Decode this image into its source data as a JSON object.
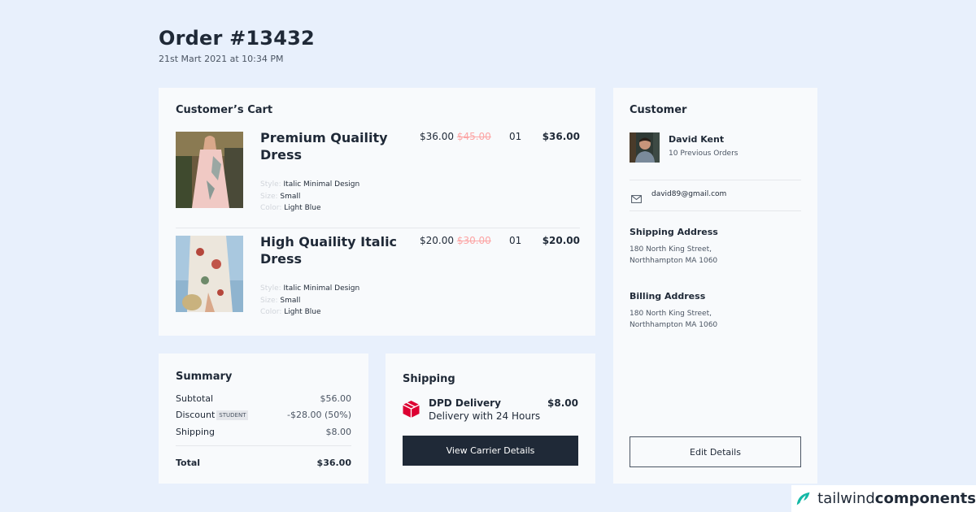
{
  "order": {
    "title": "Order #13432",
    "date": "21st Mart 2021 at 10:34 PM"
  },
  "cart": {
    "title": "Customer’s Cart",
    "items": [
      {
        "name": "Premium Quaility Dress",
        "style_label": "Style:",
        "style_value": "Italic Minimal Design",
        "size_label": "Size:",
        "size_value": "Small",
        "color_label": "Color:",
        "color_value": "Light Blue",
        "price": "$36.00",
        "old_price": "$45.00",
        "quantity": "01",
        "total": "$36.00"
      },
      {
        "name": "High Quaility Italic Dress",
        "style_label": "Style:",
        "style_value": "Italic Minimal Design",
        "size_label": "Size:",
        "size_value": "Small",
        "color_label": "Color:",
        "color_value": "Light Blue",
        "price": "$20.00",
        "old_price": "$30.00",
        "quantity": "01",
        "total": "$20.00"
      }
    ]
  },
  "summary": {
    "title": "Summary",
    "subtotal_label": "Subtotal",
    "subtotal_value": "$56.00",
    "discount_label": "Discount",
    "discount_badge": "STUDENT",
    "discount_value": "-$28.00 (50%)",
    "shipping_label": "Shipping",
    "shipping_value": "$8.00",
    "total_label": "Total",
    "total_value": "$36.00"
  },
  "shipping": {
    "title": "Shipping",
    "carrier_name": "DPD Delivery",
    "carrier_desc": "Delivery with 24 Hours",
    "carrier_price": "$8.00",
    "button_label": "View Carrier Details"
  },
  "customer": {
    "title": "Customer",
    "name": "David Kent",
    "orders": "10 Previous Orders",
    "email": "david89@gmail.com",
    "shipping_title": "Shipping Address",
    "shipping_line1": "180 North King Street,",
    "shipping_line2": "Northhampton MA 1060",
    "billing_title": "Billing Address",
    "billing_line1": "180 North King Street,",
    "billing_line2": "Northhampton MA 1060",
    "button_label": "Edit Details"
  },
  "watermark": {
    "light": "tailwind",
    "bold": "components"
  },
  "icons": {
    "carrier": "package-icon",
    "email": "mail-icon",
    "watermark": "tailwind-logo-icon"
  },
  "colors": {
    "background": "#e8f0fc",
    "card": "#f8fafc",
    "dark": "#1f2937",
    "old_price": "#fca5a5",
    "carrier": "#dc0032"
  }
}
